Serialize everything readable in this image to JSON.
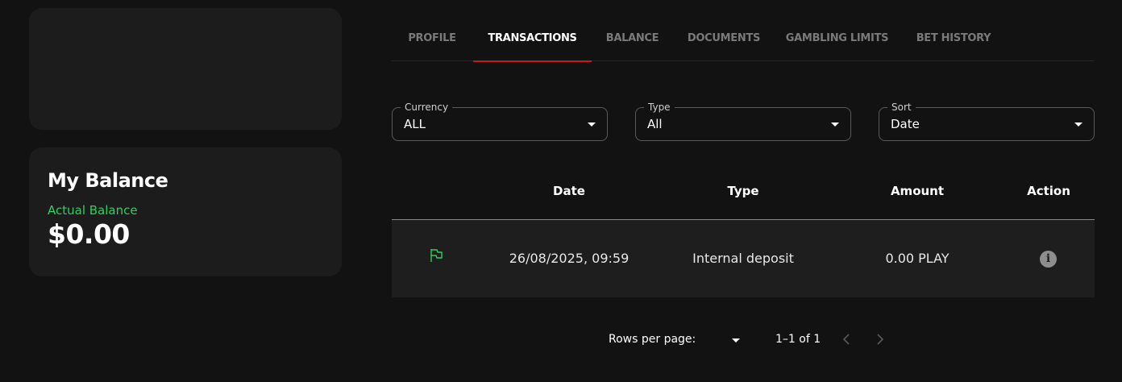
{
  "balance": {
    "title": "My Balance",
    "subtitle": "Actual Balance",
    "amount": "$0.00"
  },
  "tabs": [
    {
      "label": "PROFILE",
      "active": false
    },
    {
      "label": "TRANSACTIONS",
      "active": true
    },
    {
      "label": "BALANCE",
      "active": false
    },
    {
      "label": "DOCUMENTS",
      "active": false
    },
    {
      "label": "GAMBLING LIMITS",
      "active": false
    },
    {
      "label": "BET HISTORY",
      "active": false
    }
  ],
  "filters": {
    "currency": {
      "label": "Currency",
      "value": "ALL"
    },
    "type": {
      "label": "Type",
      "value": "All"
    },
    "sort": {
      "label": "Sort",
      "value": "Date"
    }
  },
  "table": {
    "headers": {
      "date": "Date",
      "type": "Type",
      "amount": "Amount",
      "action": "Action"
    },
    "rows": [
      {
        "icon": "flag-icon",
        "date": "26/08/2025, 09:59",
        "type": "Internal deposit",
        "amount": "0.00 PLAY",
        "action_icon": "info-icon"
      }
    ]
  },
  "pagination": {
    "rows_per_page_label": "Rows per page:",
    "range": "1–1 of 1"
  },
  "colors": {
    "accent": "#c21a1a",
    "positive": "#2fd05e",
    "background": "#121212",
    "card": "#1c1c1c"
  }
}
